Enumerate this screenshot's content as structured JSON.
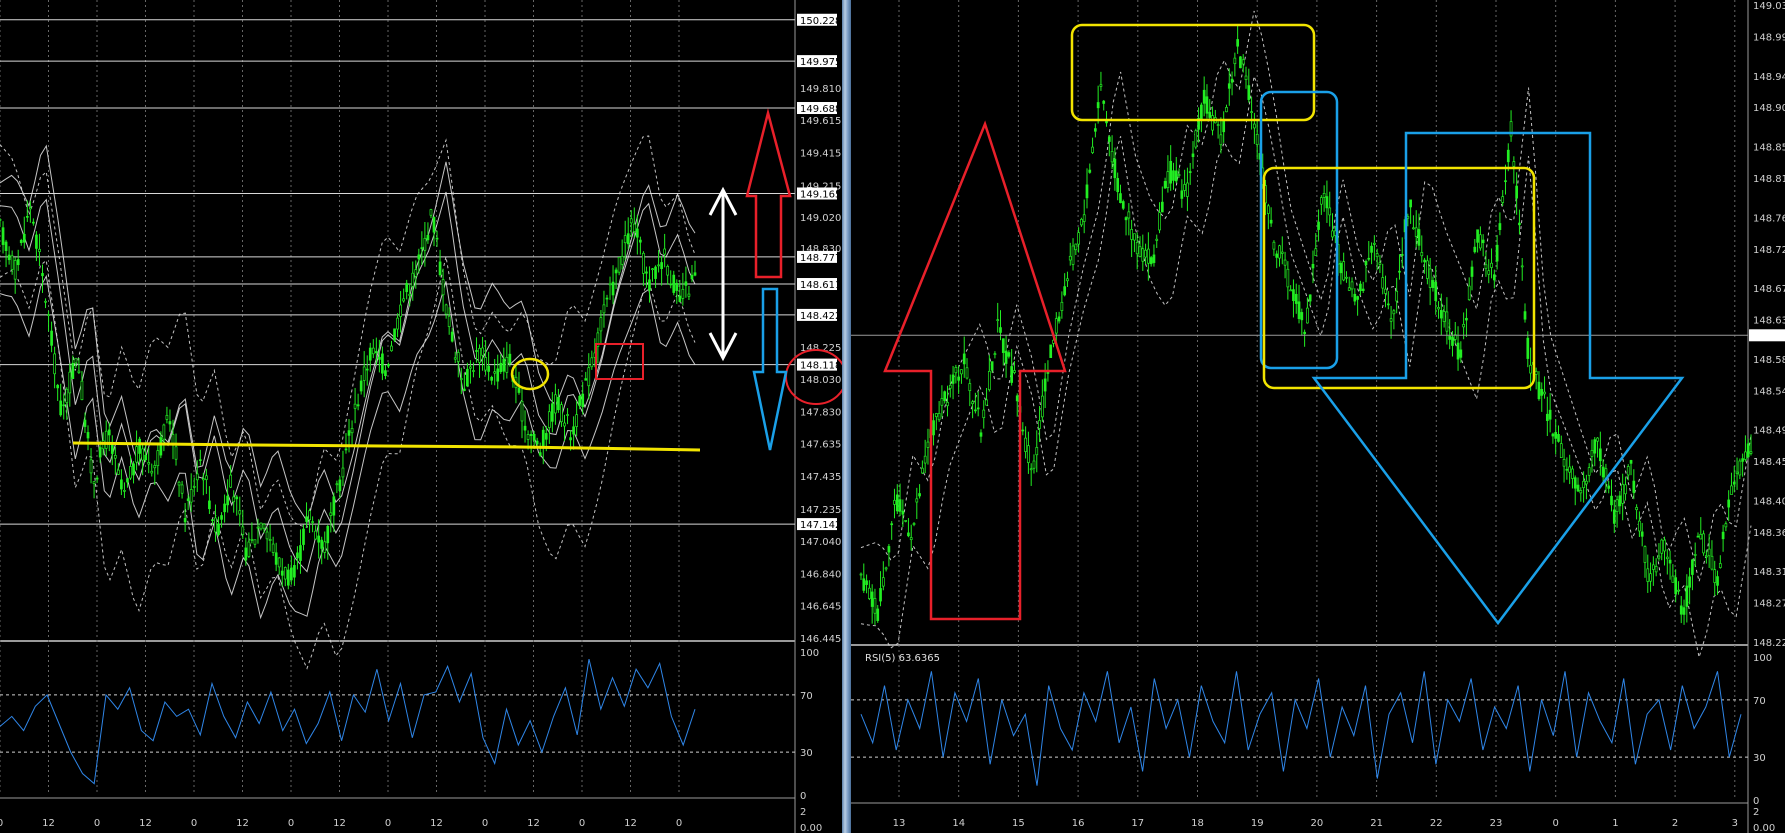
{
  "left": {
    "price_ticks": [
      "150.228",
      "149.975",
      "149.810",
      "149.688",
      "149.615",
      "149.415",
      "149.215",
      "149.165",
      "149.020",
      "148.830",
      "148.777",
      "148.611",
      "148.422",
      "148.225",
      "148.118",
      "148.030",
      "147.830",
      "147.635",
      "147.435",
      "147.235",
      "147.142",
      "147.040",
      "146.840",
      "146.645",
      "146.445"
    ],
    "boxed_levels": [
      "150.228",
      "149.975",
      "149.688",
      "149.165",
      "148.777",
      "148.611",
      "148.422",
      "148.118",
      "147.142"
    ],
    "x_labels": [
      "0",
      "12",
      "0",
      "12",
      "0",
      "12",
      "0",
      "12",
      "0",
      "12",
      "0",
      "12",
      "0",
      "12",
      "0"
    ],
    "rsi_ticks": [
      "100",
      "70",
      "30",
      "0"
    ],
    "macd_ticks": [
      "2",
      "0.00"
    ]
  },
  "right": {
    "price_ticks": [
      "149.03",
      "148.99",
      "148.94",
      "148.90",
      "148.85",
      "148.81",
      "148.76",
      "148.72",
      "148.67",
      "148.63",
      "148.61",
      "148.58",
      "148.54",
      "148.49",
      "148.45",
      "148.40",
      "148.36",
      "148.31",
      "148.27",
      "148.22"
    ],
    "x_labels": [
      "13",
      "14",
      "15",
      "16",
      "17",
      "18",
      "19",
      "20",
      "21",
      "22",
      "23",
      "0",
      "1",
      "2",
      "3"
    ],
    "rsi_label": "RSI(5) 63.6365",
    "rsi_ticks": [
      "100",
      "70",
      "30",
      "0"
    ],
    "macd_ticks": [
      "2",
      "0.00"
    ]
  },
  "colors": {
    "candles": "#22ee22",
    "rsi_line": "#2f86e8",
    "band_solid": "#e8e8e8",
    "band_dotted": "#d8d8d8",
    "support_line": "#f2e400",
    "up_arrow": "#e8202a",
    "down_arrow": "#1aa0e8",
    "level_line": "#d8d8d8"
  },
  "chart_data": [
    {
      "type": "candlestick",
      "symbol_view": "left",
      "title": "",
      "ylim": [
        146.445,
        150.3
      ],
      "horizontal_levels": [
        150.228,
        149.975,
        149.688,
        149.165,
        148.777,
        148.611,
        148.422,
        148.118,
        147.142
      ],
      "support_level": 147.66,
      "close_path": [
        148.95,
        148.7,
        149.1,
        148.5,
        147.8,
        148.2,
        147.4,
        147.7,
        147.3,
        147.6,
        147.5,
        147.8,
        147.2,
        147.55,
        147.1,
        147.4,
        146.95,
        147.2,
        146.9,
        146.8,
        147.2,
        147.0,
        147.4,
        147.85,
        148.2,
        148.1,
        148.5,
        148.7,
        149.05,
        148.4,
        148.0,
        148.2,
        148.05,
        148.15,
        147.75,
        147.6,
        147.9,
        147.7,
        148.0,
        148.4,
        148.7,
        149.0,
        148.6,
        148.8,
        148.5,
        148.65
      ],
      "rsi": {
        "name": "RSI(5)",
        "ylim": [
          0,
          100
        ],
        "levels": [
          70,
          30
        ],
        "values": [
          48,
          55,
          45,
          62,
          70,
          50,
          30,
          15,
          8,
          70,
          60,
          75,
          45,
          38,
          65,
          55,
          60,
          42,
          78,
          55,
          40,
          65,
          50,
          72,
          45,
          60,
          36,
          50,
          72,
          38,
          70,
          58,
          88,
          52,
          78,
          40,
          70,
          72,
          90,
          65,
          85,
          40,
          22,
          60,
          35,
          52,
          30,
          55,
          75,
          42,
          95,
          60,
          82,
          62,
          88,
          75,
          92,
          55,
          35,
          60
        ]
      }
    },
    {
      "type": "candlestick",
      "symbol_view": "right",
      "title": "",
      "ylim": [
        148.22,
        149.03
      ],
      "current_price": 148.61,
      "close_path": [
        148.3,
        148.26,
        148.4,
        148.36,
        148.48,
        148.53,
        148.58,
        148.49,
        148.62,
        148.55,
        148.43,
        148.58,
        148.68,
        148.76,
        148.93,
        148.8,
        148.73,
        148.7,
        148.82,
        148.79,
        148.91,
        148.86,
        148.98,
        148.88,
        148.74,
        148.68,
        148.62,
        148.8,
        148.7,
        148.65,
        148.74,
        148.62,
        148.78,
        148.7,
        148.64,
        148.58,
        148.74,
        148.68,
        148.88,
        148.58,
        148.52,
        148.46,
        148.4,
        148.48,
        148.38,
        148.44,
        148.3,
        148.35,
        148.25,
        148.36,
        148.3,
        148.43,
        148.47
      ],
      "rsi": {
        "name": "RSI(5)",
        "value": 63.6365,
        "ylim": [
          0,
          100
        ],
        "levels": [
          70,
          30
        ],
        "values": [
          60,
          40,
          80,
          35,
          70,
          50,
          90,
          30,
          75,
          55,
          85,
          25,
          70,
          45,
          60,
          10,
          80,
          50,
          35,
          75,
          55,
          90,
          40,
          65,
          20,
          85,
          50,
          70,
          30,
          80,
          55,
          40,
          90,
          35,
          60,
          75,
          20,
          70,
          50,
          85,
          30,
          65,
          45,
          80,
          15,
          60,
          75,
          40,
          90,
          25,
          70,
          55,
          85,
          35,
          65,
          50,
          80,
          20,
          70,
          45,
          90,
          30,
          75,
          55,
          40,
          85,
          25,
          60,
          70,
          35,
          80,
          50,
          65,
          90,
          30,
          60
        ]
      }
    }
  ]
}
